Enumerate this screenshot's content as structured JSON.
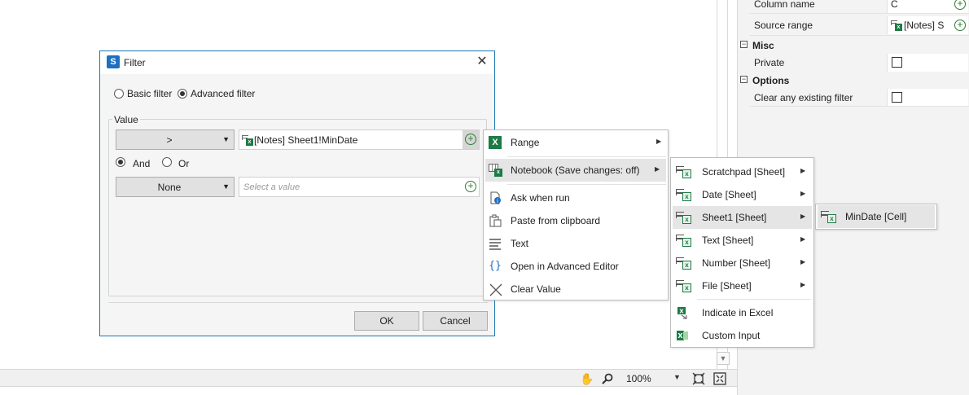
{
  "properties": {
    "rows": [
      {
        "label": "Column name",
        "value": "C"
      },
      {
        "label": "Source range",
        "value": "[Notes] S"
      }
    ],
    "groups": [
      {
        "label": "Misc",
        "rows": [
          {
            "label": "Private",
            "checked": false
          }
        ]
      },
      {
        "label": "Options",
        "rows": [
          {
            "label": "Clear any existing filter",
            "checked": false
          }
        ]
      }
    ]
  },
  "dialog": {
    "title": "Filter",
    "mode_basic": "Basic filter",
    "mode_advanced": "Advanced filter",
    "selected_mode": "Advanced filter",
    "group_label": "Value",
    "condition1": {
      "operator": ">",
      "value": "[Notes] Sheet1!MinDate"
    },
    "logic_and": "And",
    "logic_or": "Or",
    "selected_logic": "And",
    "condition2": {
      "operator": "None",
      "placeholder": "Select a value"
    },
    "ok_label": "OK",
    "cancel_label": "Cancel"
  },
  "context_menu": {
    "items": [
      {
        "label": "Range",
        "icon": "excel-icon",
        "submenu": true
      },
      {
        "label": "Notebook (Save changes: off)",
        "icon": "notebook-icon",
        "submenu": true
      },
      {
        "label": "Ask when run",
        "icon": "ask-icon"
      },
      {
        "label": "Paste from clipboard",
        "icon": "clipboard-icon"
      },
      {
        "label": "Text",
        "icon": "text-icon"
      },
      {
        "label": "Open in Advanced Editor",
        "icon": "braces-icon"
      },
      {
        "label": "Clear Value",
        "icon": "clear-icon"
      }
    ]
  },
  "notebook_menu": {
    "items": [
      {
        "label": "Scratchpad [Sheet]"
      },
      {
        "label": "Date [Sheet]"
      },
      {
        "label": "Sheet1 [Sheet]"
      },
      {
        "label": "Text [Sheet]"
      },
      {
        "label": "Number [Sheet]"
      },
      {
        "label": "File [Sheet]"
      },
      {
        "label": "Indicate in Excel"
      },
      {
        "label": "Custom Input"
      }
    ]
  },
  "sheet_menu": {
    "items": [
      {
        "label": "MinDate [Cell]"
      }
    ]
  },
  "statusbar": {
    "zoom": "100%"
  },
  "colors": {
    "accent": "#1c78b5",
    "excel_green": "#1d7a45",
    "highlight": "#e5e5e5"
  }
}
